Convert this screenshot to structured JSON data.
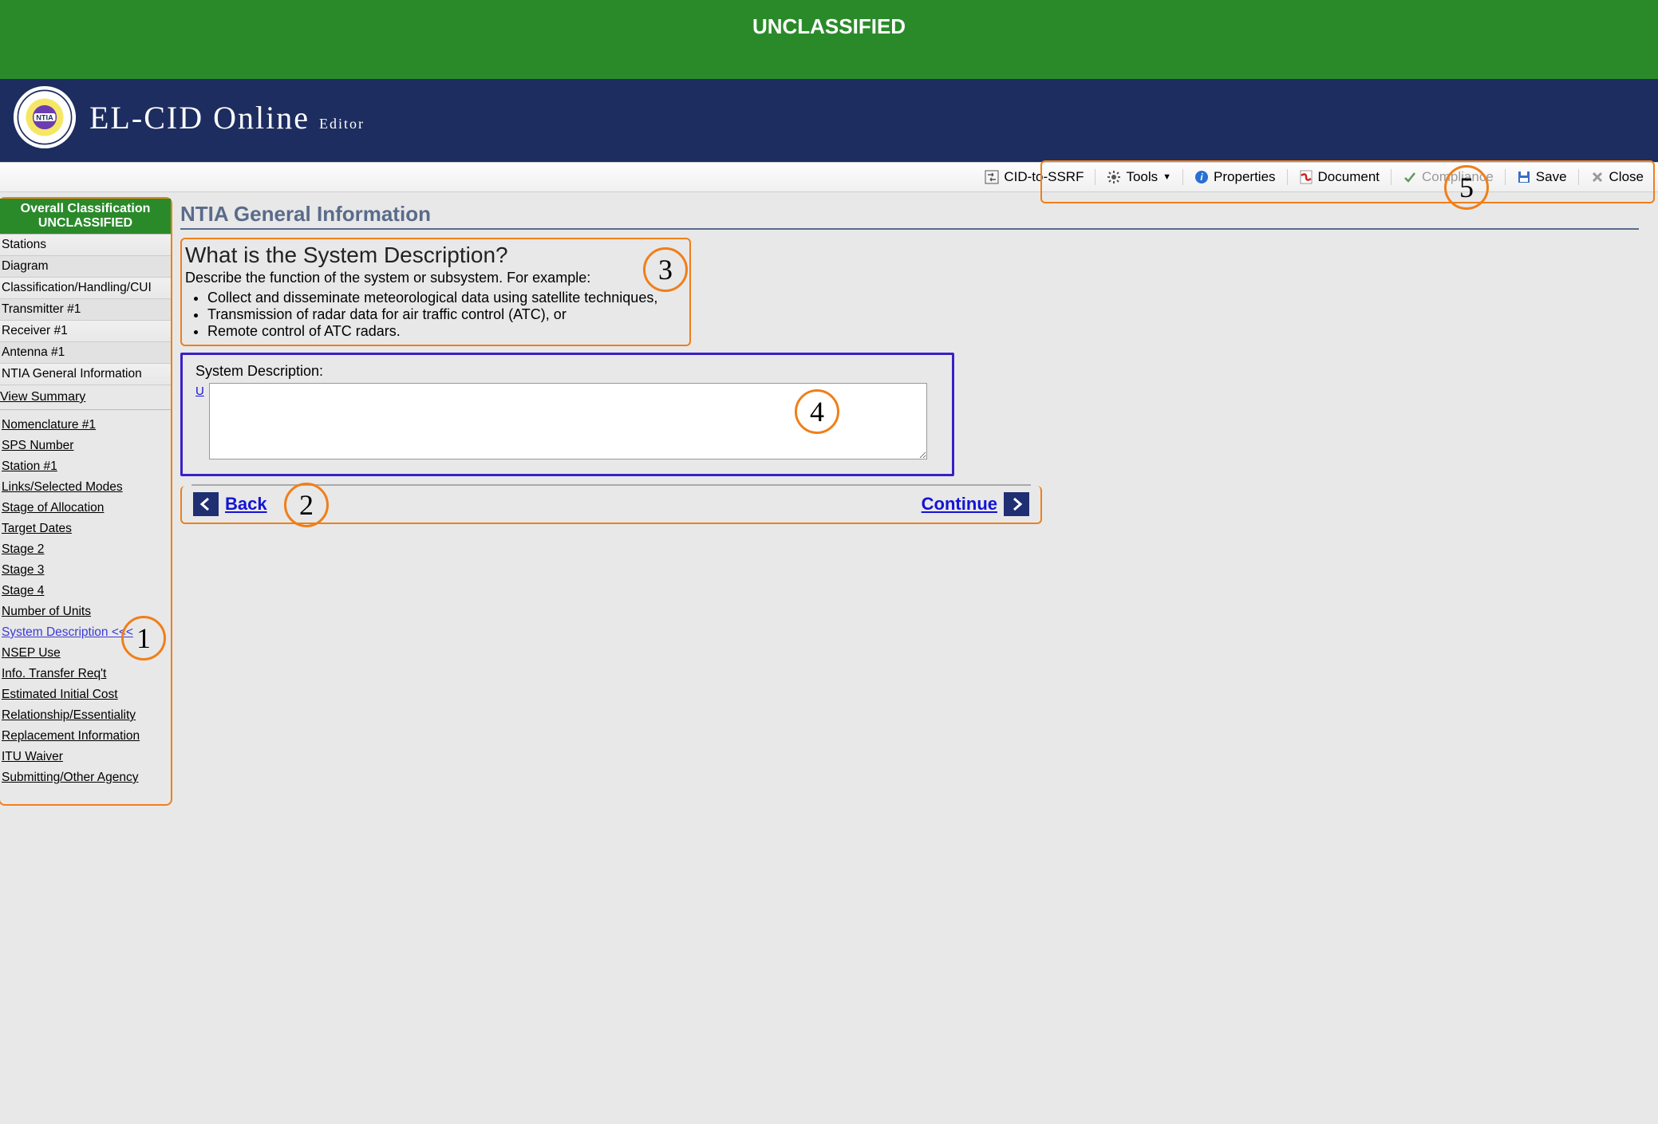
{
  "classification_banner": "UNCLASSIFIED",
  "app": {
    "logo_alt": "NTIA",
    "title_main": "EL-CID Online",
    "title_sub": "Editor"
  },
  "toolbar": {
    "cid_ssrf": "CID-to-SSRF",
    "tools": "Tools",
    "properties": "Properties",
    "document": "Document",
    "compliance": "Compliance",
    "save": "Save",
    "close": "Close"
  },
  "sidebar": {
    "class_header_line1": "Overall Classification",
    "class_header_line2": "UNCLASSIFIED",
    "top_items": [
      "Stations",
      "Diagram",
      "Classification/Handling/CUI",
      "Transmitter #1",
      "Receiver #1",
      "Antenna #1",
      "NTIA General Information"
    ],
    "view_summary": "View Summary",
    "links": [
      "Nomenclature #1",
      "SPS Number",
      "Station #1",
      "Links/Selected Modes",
      "Stage of Allocation",
      "Target Dates",
      "Stage 2",
      "Stage 3",
      "Stage 4",
      "Number of Units",
      "System Description <<<",
      "NSEP Use",
      "Info. Transfer Req't",
      "Estimated Initial Cost",
      "Relationship/Essentiality",
      "Replacement Information",
      "ITU Waiver",
      "Submitting/Other Agency"
    ],
    "current_link_index": 10
  },
  "content": {
    "section_title": "NTIA General Information",
    "question_title": "What is the System Description?",
    "question_desc_lead": "Describe the function of the system or subsystem. For example:",
    "question_bullets": [
      "Collect and disseminate meteorological data using satellite techniques,",
      "Transmission of radar data for air traffic control (ATC), or",
      "Remote control of ATC radars."
    ],
    "input_label": "System Description:",
    "u_marker": "U",
    "textarea_value": "",
    "back_label": "Back",
    "continue_label": "Continue"
  },
  "annotations": {
    "1": "1",
    "2": "2",
    "3": "3",
    "4": "4",
    "5": "5"
  }
}
